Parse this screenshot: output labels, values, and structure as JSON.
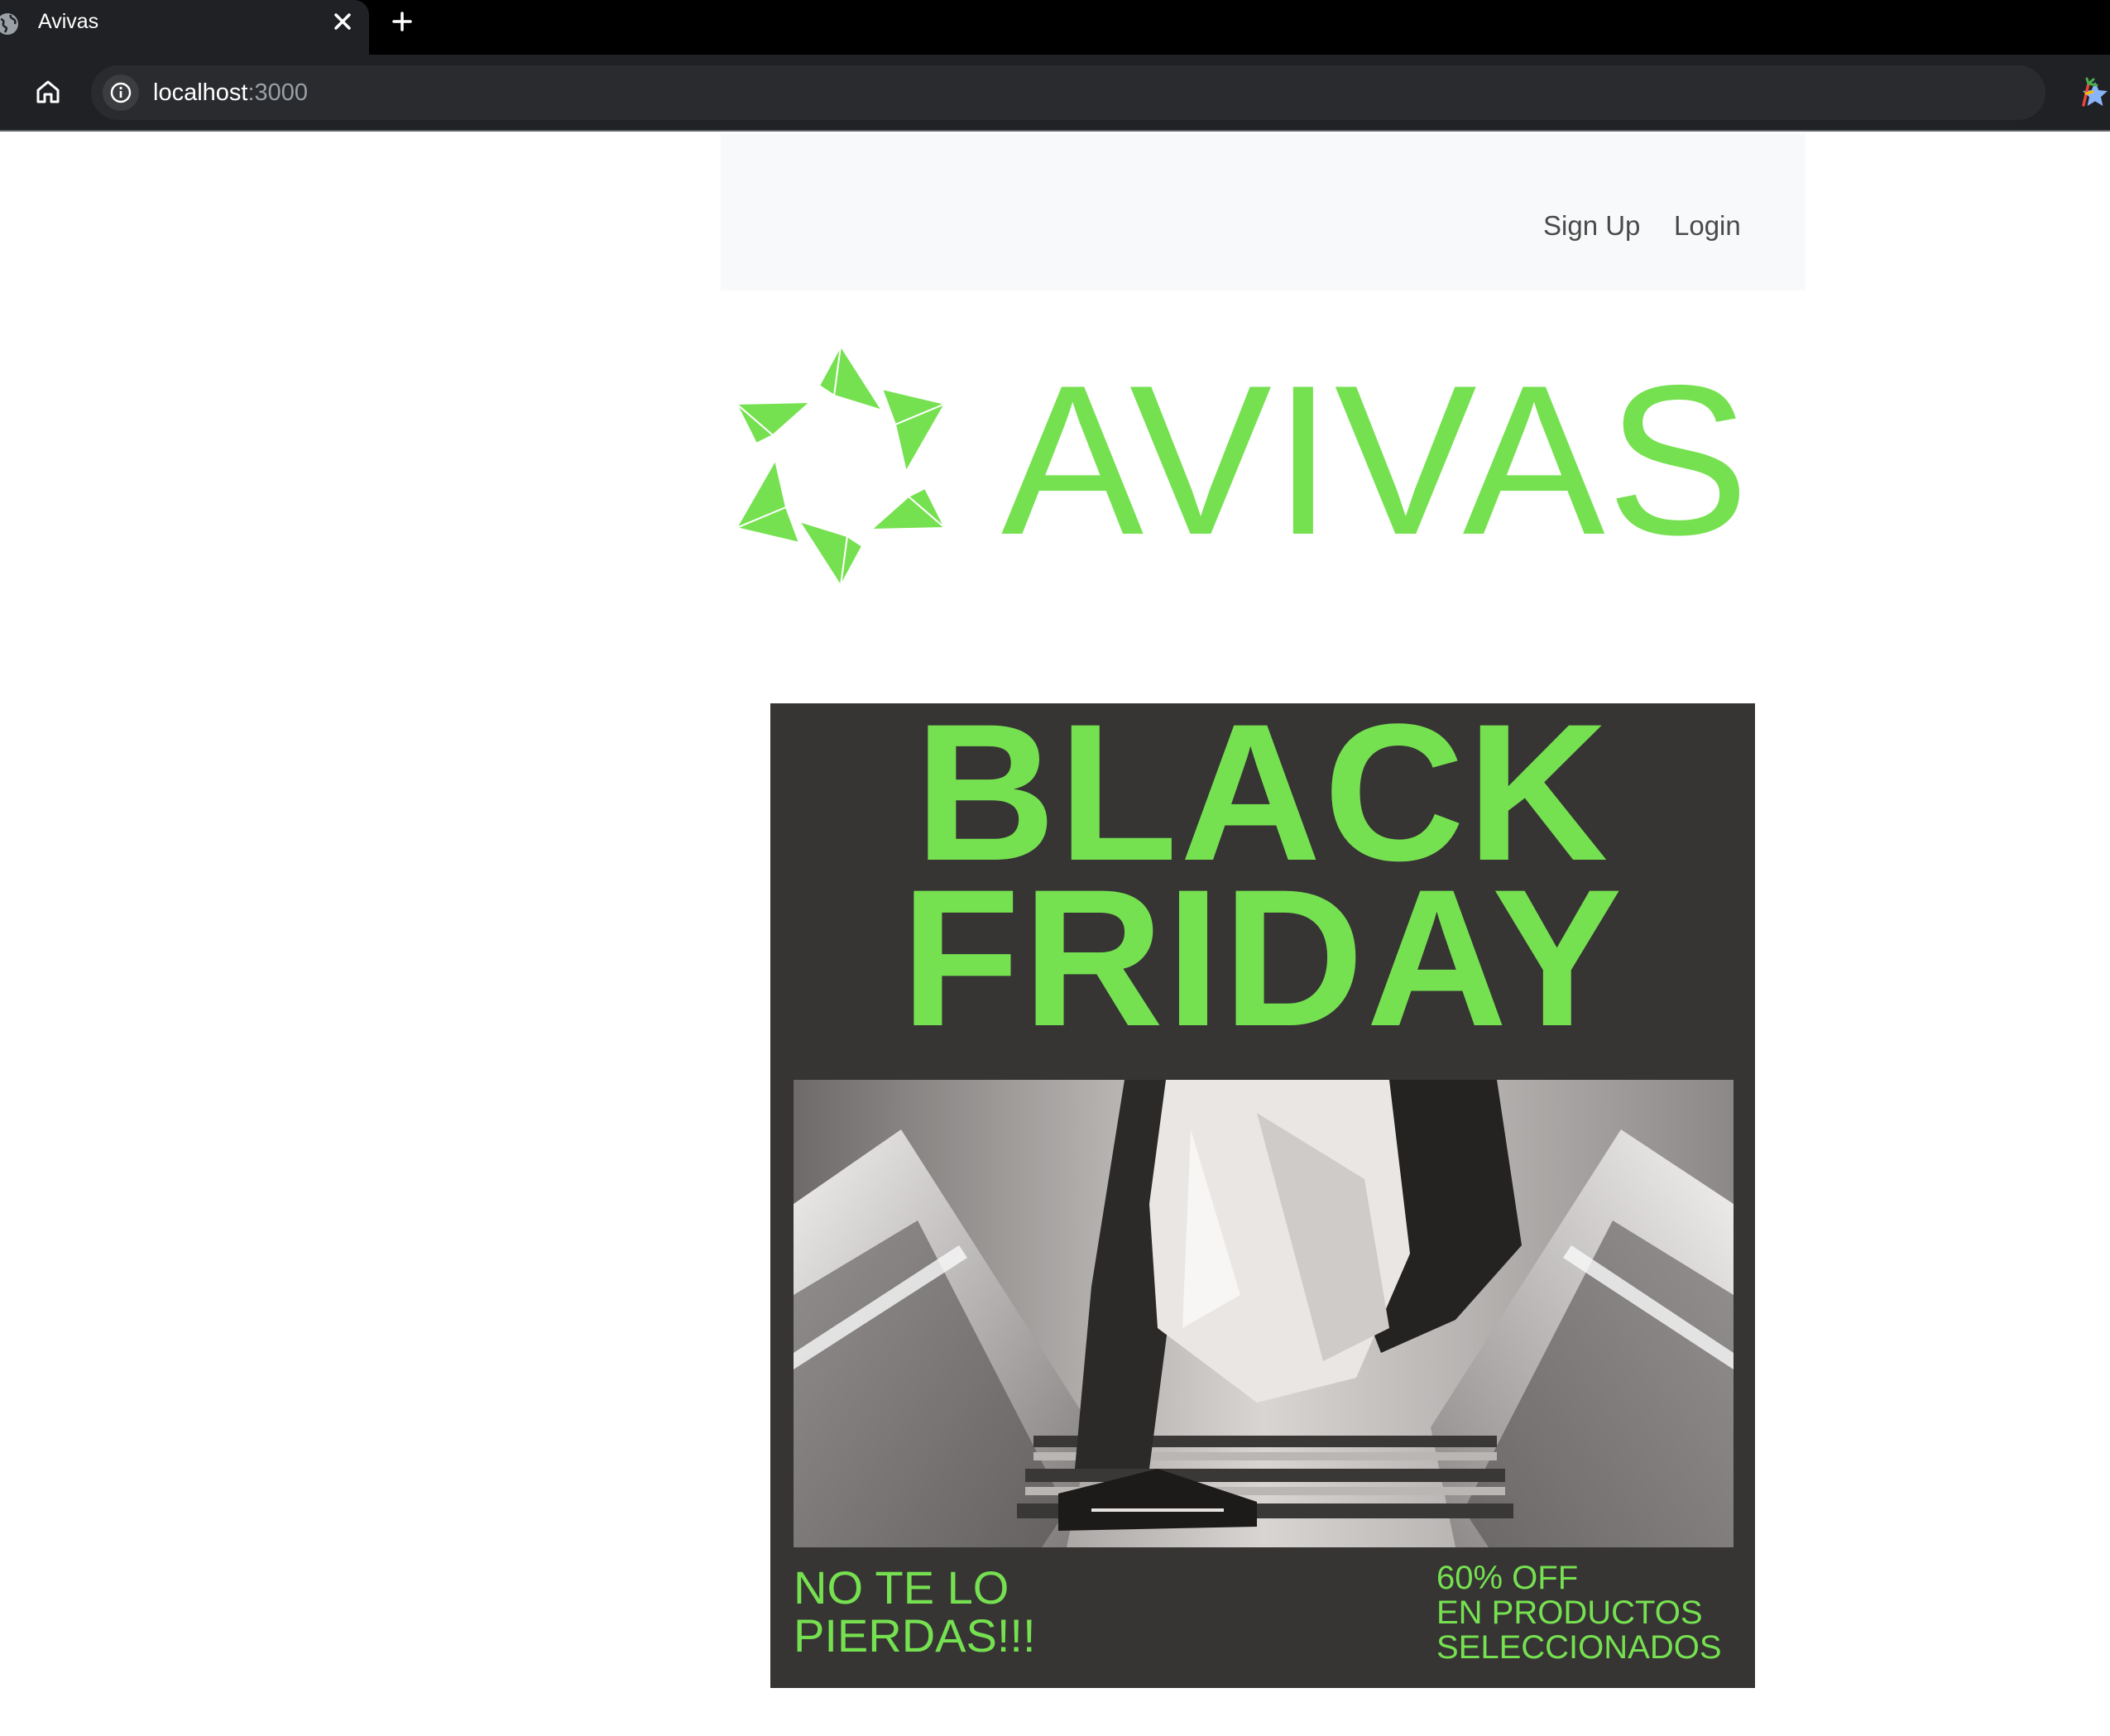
{
  "browser": {
    "tab_title": "Avivas",
    "url_host": "localhost",
    "url_port": ":3000",
    "icons": {
      "tab_favicon": "globe-icon",
      "tab_close": "close-icon",
      "new_tab": "plus-icon",
      "home": "home-icon",
      "site_info": "info-icon",
      "bookmark": "star-icon",
      "extension": "extension-icon"
    },
    "colors": {
      "tabstrip": "#000000",
      "toolbar": "#202124",
      "bookmark_star": "#8ab4f8"
    }
  },
  "navbar": {
    "signup_label": "Sign Up",
    "login_label": "Login"
  },
  "brand": {
    "name": "AVIVAS",
    "color": "#76e150"
  },
  "banner": {
    "line1": "BLACK",
    "line2": "FRIDAY",
    "bottom_left": "NO TE LO\nPIERDAS!!!",
    "bottom_right": "60% OFF\nEN PRODUCTOS\nSELECCIONADOS",
    "background": "#363534",
    "text_color": "#76e150"
  }
}
